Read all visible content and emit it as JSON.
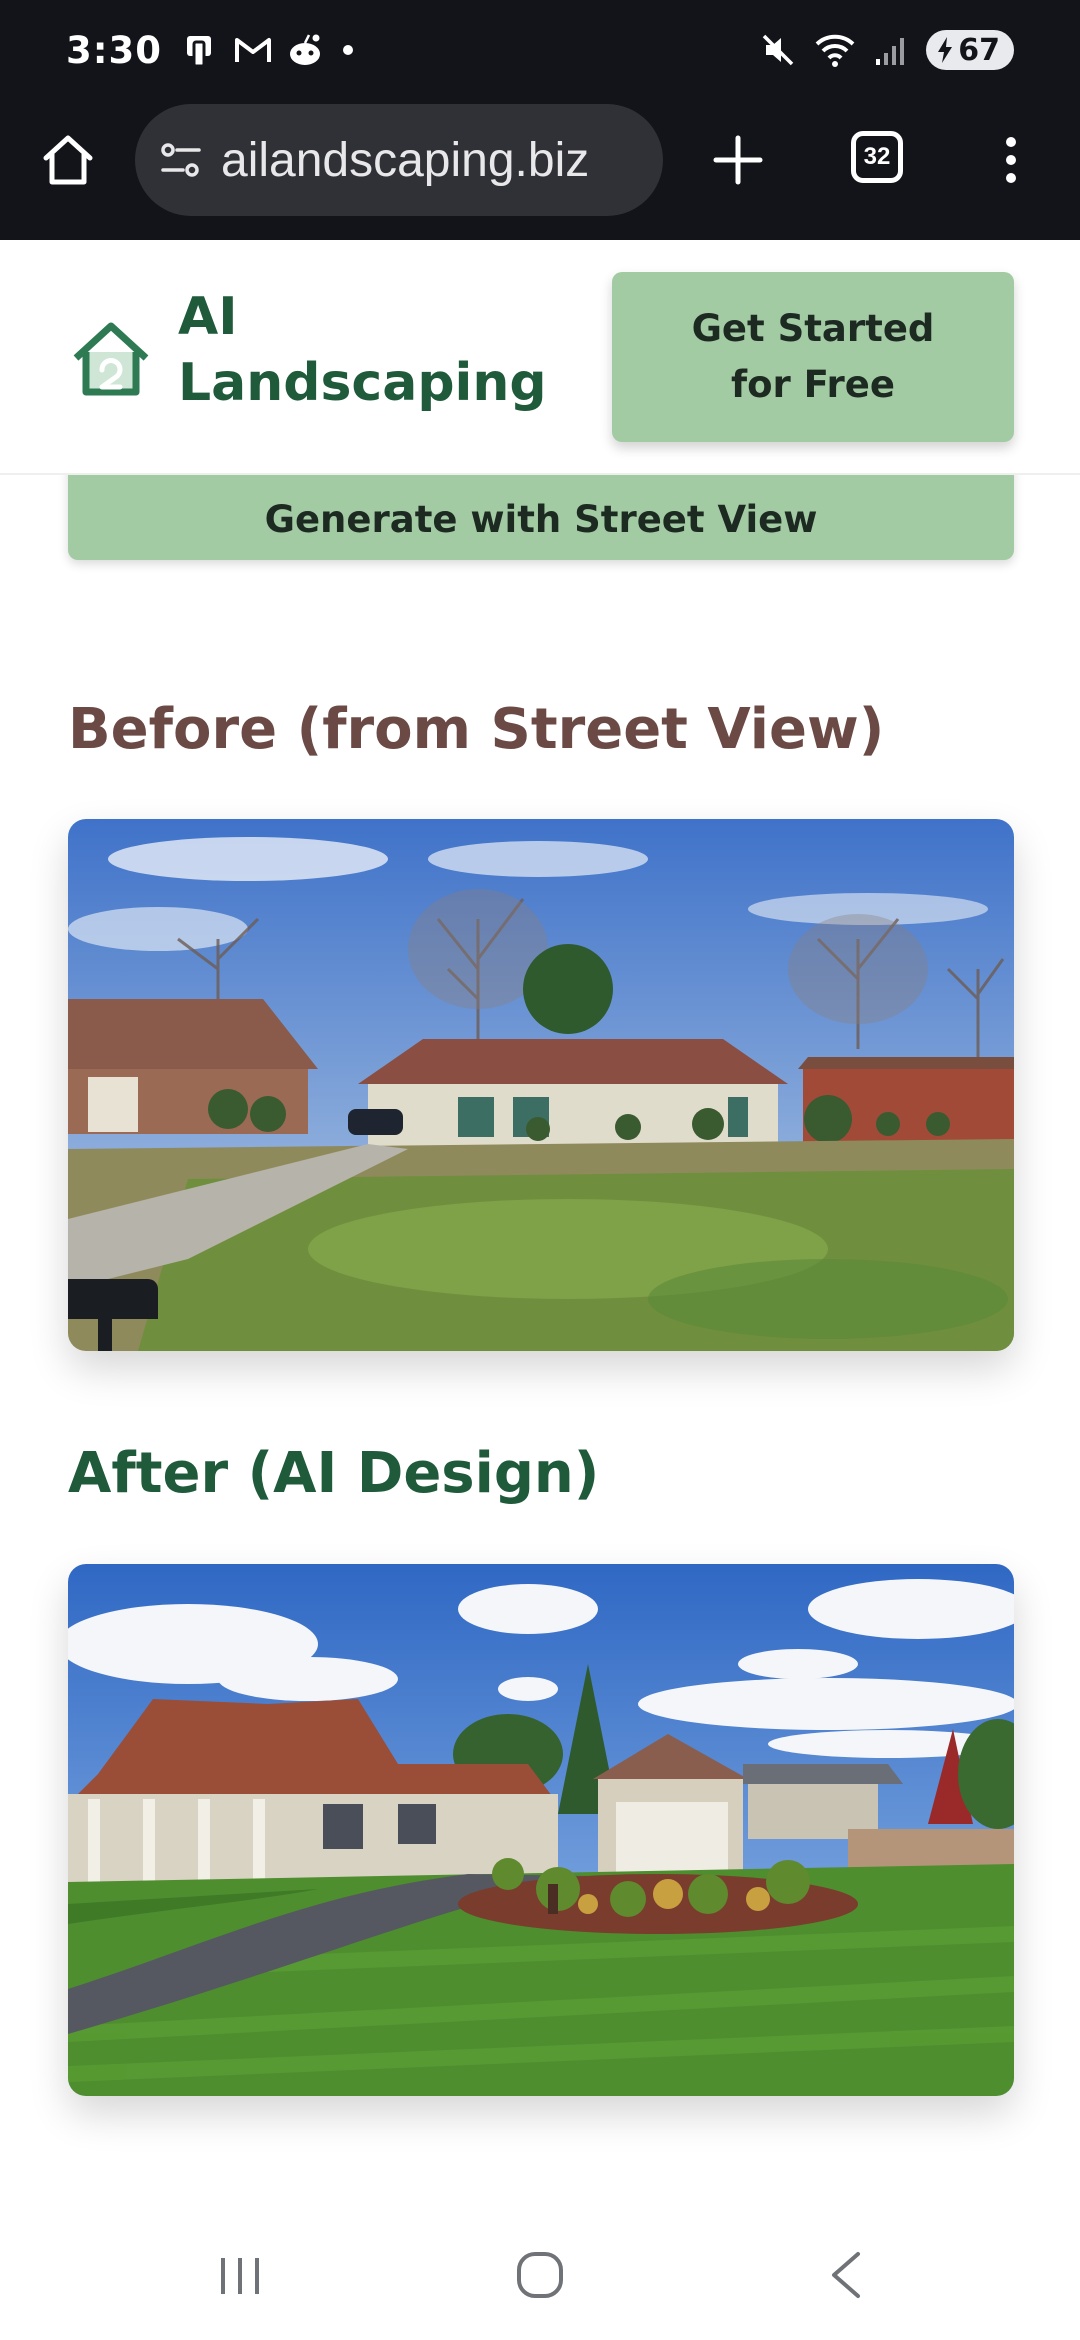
{
  "status_bar": {
    "time": "3:30",
    "battery_level": "67",
    "icons": [
      "notification-app-icon",
      "gmail-icon",
      "reddit-icon",
      "dot-icon",
      "mute-icon",
      "wifi-icon",
      "signal-icon",
      "battery-charging-icon"
    ]
  },
  "browser": {
    "url": "ailandscaping.biz",
    "tab_count": "32",
    "icons": [
      "home-icon",
      "site-info-icon",
      "plus-icon",
      "tab-switcher-icon",
      "more-vert-icon"
    ]
  },
  "header": {
    "logo_line1": "AI",
    "logo_line2": "Landscaping",
    "cta_line1": "Get Started",
    "cta_line2": "for Free"
  },
  "main": {
    "street_view_button": "Generate with Street View",
    "before_title": "Before (from Street View)",
    "after_title": "After (AI Design)"
  },
  "nav_bar": {
    "icons": [
      "recents-icon",
      "home-circle-icon",
      "back-icon"
    ]
  },
  "colors": {
    "brand_green": "#1f5a3a",
    "button_green": "#a3cba3",
    "before_title": "#6b4a46",
    "browser_bg": "#12141a"
  }
}
